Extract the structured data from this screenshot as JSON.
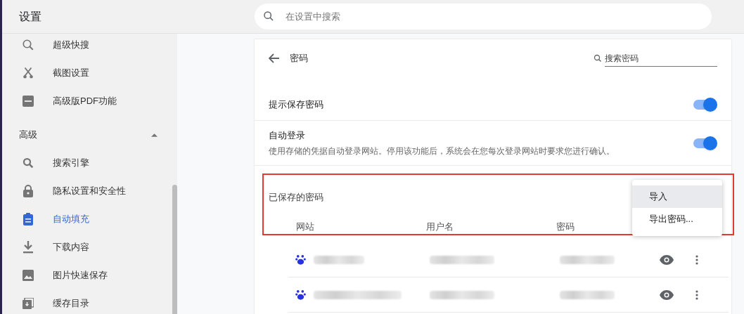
{
  "header": {
    "title": "设置",
    "search": {
      "placeholder": "在设置中搜索"
    }
  },
  "sidebar": {
    "items": [
      {
        "label": "超级快搜",
        "kind": "search-outline",
        "selected": false
      },
      {
        "label": "截图设置",
        "kind": "scissors",
        "selected": false
      },
      {
        "label": "高级版PDF功能",
        "kind": "pdf",
        "selected": false
      }
    ],
    "section": {
      "label": "高级",
      "expanded": true,
      "items": [
        {
          "label": "搜索引擎",
          "kind": "search",
          "selected": false
        },
        {
          "label": "隐私设置和安全性",
          "kind": "lock",
          "selected": false
        },
        {
          "label": "自动填充",
          "kind": "clipboard",
          "selected": true
        },
        {
          "label": "下载内容",
          "kind": "download",
          "selected": false
        },
        {
          "label": "图片快速保存",
          "kind": "image",
          "selected": false
        },
        {
          "label": "缓存目录",
          "kind": "cache",
          "selected": false
        }
      ]
    }
  },
  "page": {
    "title": "密码",
    "search": {
      "placeholder": "搜索密码"
    },
    "toggles": [
      {
        "label": "提示保存密码",
        "on": true
      },
      {
        "label": "自动登录",
        "description": "使用存储的凭据自动登录网站。停用该功能后，系统会在您每次登录网站时要求您进行确认。",
        "on": true
      }
    ],
    "saved": {
      "title": "已保存的密码",
      "columns": [
        "网站",
        "用户名",
        "密码"
      ],
      "menu": [
        {
          "label": "导入",
          "selected": true
        },
        {
          "label": "导出密码...",
          "selected": false
        }
      ],
      "rows": [
        {
          "kind": "redacted"
        },
        {
          "kind": "redacted"
        }
      ]
    }
  }
}
